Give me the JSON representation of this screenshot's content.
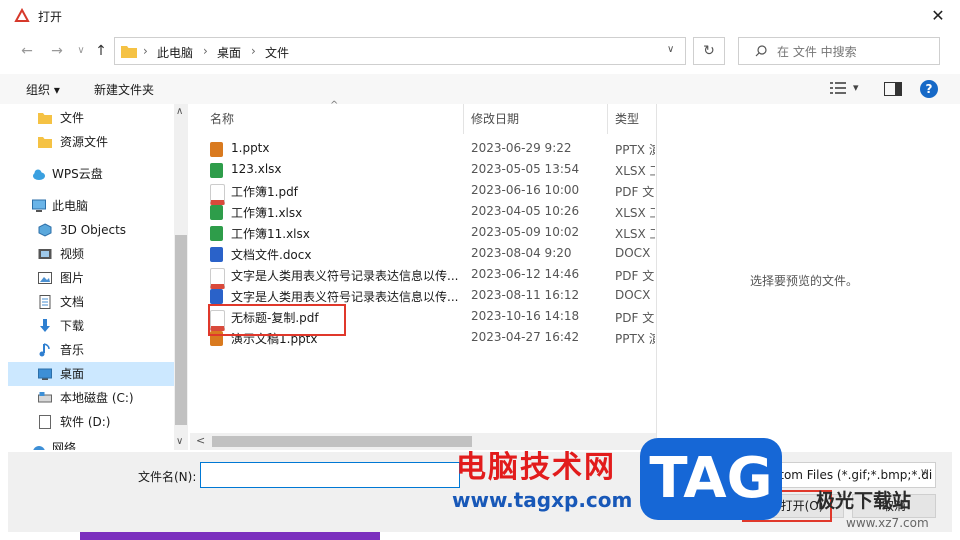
{
  "window": {
    "title": "打开",
    "close_glyph": "✕"
  },
  "nav": {
    "back_glyph": "←",
    "forward_glyph": "→",
    "dropdown_glyph": "∨",
    "up_glyph": "↑",
    "breadcrumb": [
      "此电脑",
      "桌面",
      "文件"
    ],
    "separator": "›",
    "addr_dropdown_glyph": "∨",
    "refresh_glyph": "↻",
    "search_placeholder": "在 文件 中搜索"
  },
  "toolbar": {
    "organize_label": "组织 ▾",
    "new_folder_label": "新建文件夹",
    "view_glyph": "▾",
    "help_glyph": "?"
  },
  "sidebar": {
    "items": [
      {
        "label": "文件",
        "icon": "folder-icon"
      },
      {
        "label": "资源文件",
        "icon": "folder-icon"
      },
      {
        "label": "WPS云盘",
        "icon": "cloud-icon"
      },
      {
        "label": "此电脑",
        "icon": "computer-icon"
      },
      {
        "label": "3D Objects",
        "icon": "cube-icon"
      },
      {
        "label": "视频",
        "icon": "video-icon"
      },
      {
        "label": "图片",
        "icon": "picture-icon"
      },
      {
        "label": "文档",
        "icon": "document-icon"
      },
      {
        "label": "下载",
        "icon": "download-icon"
      },
      {
        "label": "音乐",
        "icon": "music-icon"
      },
      {
        "label": "桌面",
        "icon": "desktop-icon",
        "selected": true
      },
      {
        "label": "本地磁盘 (C:)",
        "icon": "drive-icon"
      },
      {
        "label": "软件 (D:)",
        "icon": "drive-icon"
      },
      {
        "label": "网络",
        "icon": "network-icon"
      }
    ],
    "scroll_up": "∧",
    "scroll_down": "∨"
  },
  "files": {
    "columns": {
      "name": "名称",
      "date": "修改日期",
      "type": "类型"
    },
    "sort_glyph": "^",
    "rows": [
      {
        "name": "1.pptx",
        "date": "2023-06-29 9:22",
        "type": "PPTX 演",
        "icon_color": "#d97a1f"
      },
      {
        "name": "123.xlsx",
        "date": "2023-05-05 13:54",
        "type": "XLSX 工",
        "icon_color": "#2e9d4a"
      },
      {
        "name": "工作簿1.pdf",
        "date": "2023-06-16 10:00",
        "type": "PDF 文",
        "icon_color": "#d94a3b"
      },
      {
        "name": "工作簿1.xlsx",
        "date": "2023-04-05 10:26",
        "type": "XLSX 工",
        "icon_color": "#2e9d4a"
      },
      {
        "name": "工作簿11.xlsx",
        "date": "2023-05-09 10:02",
        "type": "XLSX 工",
        "icon_color": "#2e9d4a"
      },
      {
        "name": "文档文件.docx",
        "date": "2023-08-04 9:20",
        "type": "DOCX",
        "icon_color": "#2a62c9"
      },
      {
        "name": "文字是人类用表义符号记录表达信息以传...",
        "date": "2023-06-12 14:46",
        "type": "PDF 文",
        "icon_color": "#d94a3b"
      },
      {
        "name": "文字是人类用表义符号记录表达信息以传...",
        "date": "2023-08-11 16:12",
        "type": "DOCX",
        "icon_color": "#2a62c9"
      },
      {
        "name": "无标题-复制.pdf",
        "date": "2023-10-16 14:18",
        "type": "PDF 文",
        "icon_color": "#d94a3b"
      },
      {
        "name": "演示文稿1.pptx",
        "date": "2023-04-27 16:42",
        "type": "PPTX 演",
        "icon_color": "#d97a1f"
      }
    ],
    "hscroll_left": "<"
  },
  "preview": {
    "message": "选择要预览的文件。"
  },
  "bottom": {
    "filename_label": "文件名(N):",
    "filename_value": "",
    "filter_value": "Custom Files (*.gif;*.bmp;*.di",
    "open_label": "打开(O)",
    "cancel_label": "取消"
  },
  "watermark": {
    "cn": "电脑技术网",
    "url": "www.tagxp.com",
    "tag": "TAG",
    "site2": "极光下载站",
    "site2_url": "www.xz7.com"
  }
}
